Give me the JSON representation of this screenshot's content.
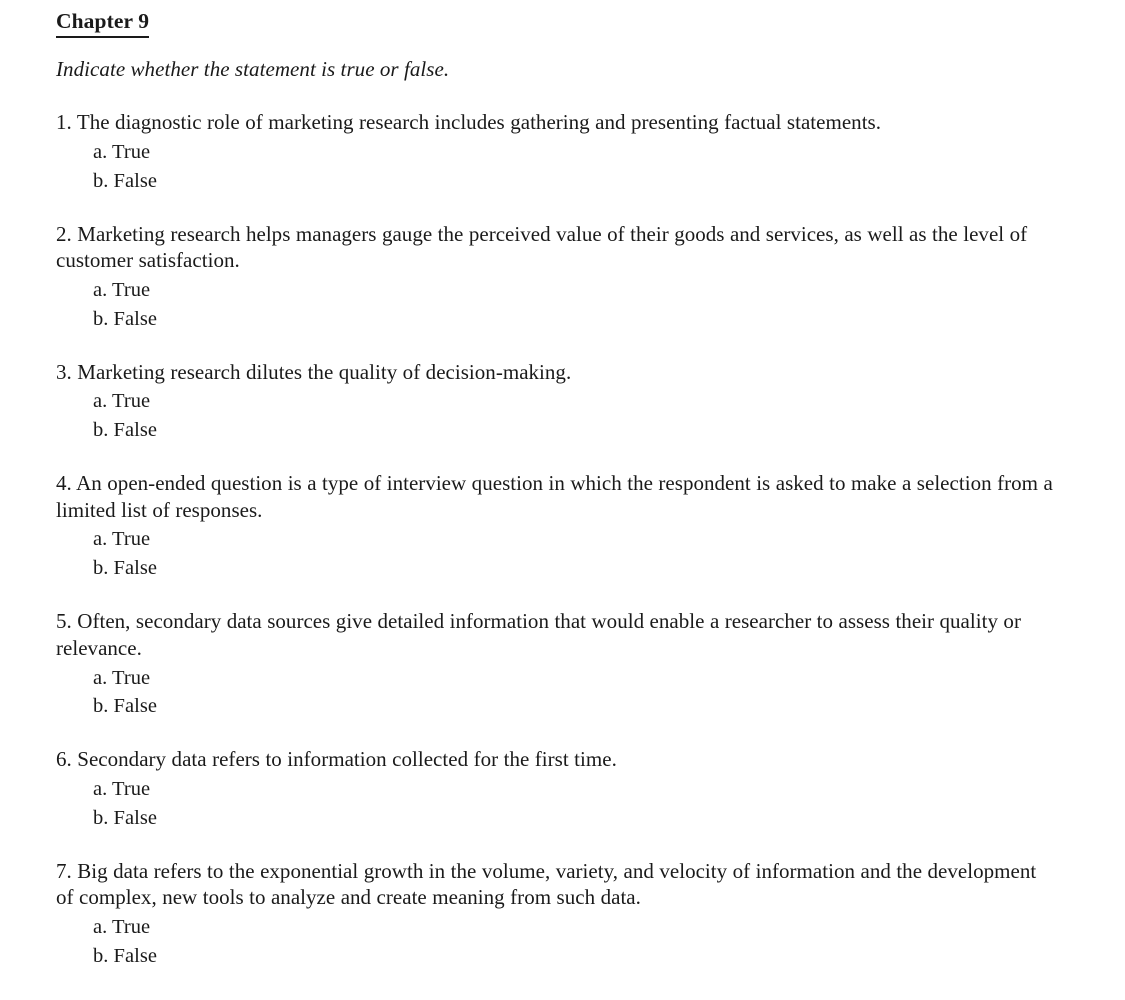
{
  "document": {
    "chapter_title": "Chapter 9",
    "instruction": "Indicate whether the statement is true or false.",
    "questions": [
      {
        "number": "1.",
        "text": "1. The diagnostic role of marketing research includes gathering and presenting factual statements.",
        "options": [
          {
            "label": "a. True"
          },
          {
            "label": "b. False"
          }
        ]
      },
      {
        "number": "2.",
        "text": "2. Marketing research helps managers gauge the perceived value of their goods and services, as well as the level of customer satisfaction.",
        "options": [
          {
            "label": "a. True"
          },
          {
            "label": "b. False"
          }
        ]
      },
      {
        "number": "3.",
        "text": "3. Marketing research dilutes the quality of decision-making.",
        "options": [
          {
            "label": "a. True"
          },
          {
            "label": "b. False"
          }
        ]
      },
      {
        "number": "4.",
        "text": "4. An open-ended question is a type of interview question in which the respondent is asked to make a selection from a limited list of responses.",
        "options": [
          {
            "label": "a. True"
          },
          {
            "label": "b. False"
          }
        ]
      },
      {
        "number": "5.",
        "text": "5. Often, secondary data sources give detailed information that would enable a researcher to assess their quality or relevance.",
        "options": [
          {
            "label": "a. True"
          },
          {
            "label": "b. False"
          }
        ]
      },
      {
        "number": "6.",
        "text": "6. Secondary data refers to information collected for the first time.",
        "options": [
          {
            "label": "a. True"
          },
          {
            "label": "b. False"
          }
        ]
      },
      {
        "number": "7.",
        "text": "7. Big data refers to the exponential growth in the volume, variety, and velocity of information and the development of complex, new tools to analyze and create meaning from such data.",
        "options": [
          {
            "label": "a. True"
          },
          {
            "label": "b. False"
          }
        ]
      }
    ]
  },
  "colors": {
    "page_background": "#ffffff",
    "text": "#1a1a1a"
  }
}
